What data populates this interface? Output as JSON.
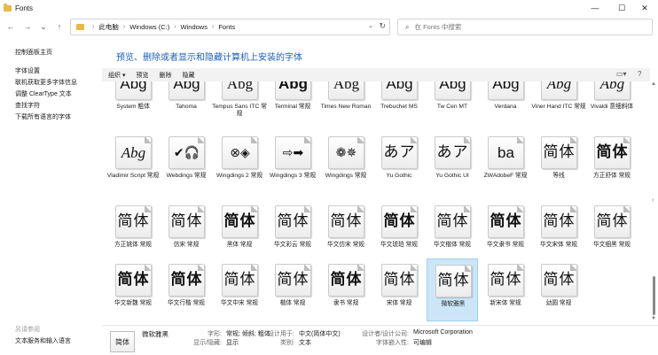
{
  "window": {
    "title": "Fonts",
    "min": "—",
    "max": "☐",
    "close": "✕"
  },
  "nav": {
    "back": "←",
    "forward": "→",
    "history": "⌄",
    "up": "↑",
    "breadcrumb": [
      "此电脑",
      "Windows (C:)",
      "Windows",
      "Fonts"
    ],
    "search_placeholder": "在 Fonts 中搜索"
  },
  "left": {
    "home": "控制面板主页",
    "links": [
      "字体设置",
      "联机获取更多字体信息",
      "调整 ClearType 文本",
      "查找字符",
      "下载所有语言的字体"
    ],
    "see_also": "另请参阅",
    "see_also_links": [
      "文本服务和输入语言"
    ]
  },
  "header": {
    "title": "预览、删除或者显示和隐藏计算机上安装的字体"
  },
  "toolbar": {
    "organize": "组织 ▾",
    "preview": "预览",
    "delete": "删除",
    "hide": "隐藏"
  },
  "fonts": [
    {
      "sample": "Abg",
      "style": "g-sans",
      "label": "System 粗体"
    },
    {
      "sample": "Abg",
      "style": "g-sans",
      "label": "Tahoma"
    },
    {
      "sample": "Abg",
      "style": "g-serif",
      "label": "Tempus Sans ITC 常规"
    },
    {
      "sample": "Abg",
      "style": "g-sans g-bold",
      "label": "Terminal 常规"
    },
    {
      "sample": "Abg",
      "style": "g-serif",
      "label": "Times New Roman"
    },
    {
      "sample": "Abg",
      "style": "g-sans",
      "label": "Trebuchet MS"
    },
    {
      "sample": "Abg",
      "style": "g-sans",
      "label": "Tw Cen MT"
    },
    {
      "sample": "Abg",
      "style": "g-sans",
      "label": "Verdana"
    },
    {
      "sample": "Abg",
      "style": "g-italic",
      "label": "Viner Hand ITC 常规"
    },
    {
      "sample": "Abg",
      "style": "g-italic",
      "label": "Vivaldi 意细斜体"
    },
    {
      "sample": "Abg",
      "style": "g-italic",
      "label": "Vladimir Script 常规"
    },
    {
      "sample": "✔🎧",
      "style": "g-sym",
      "label": "Webdings 常规"
    },
    {
      "sample": "⊗◈",
      "style": "g-sym",
      "label": "Wingdings 2 常规"
    },
    {
      "sample": "⇨➡",
      "style": "g-sym",
      "label": "Wingdings 3 常规"
    },
    {
      "sample": "❁✵",
      "style": "g-sym",
      "label": "Wingdings 常规"
    },
    {
      "sample": "あア",
      "style": "g-cjk",
      "label": "Yu Gothic"
    },
    {
      "sample": "あア",
      "style": "g-cjk",
      "label": "Yu Gothic UI"
    },
    {
      "sample": "ba",
      "style": "g-sans",
      "label": "ZWAdobeF 常规"
    },
    {
      "sample": "简体",
      "style": "g-cjk",
      "label": "等线"
    },
    {
      "sample": "简体",
      "style": "g-cjk g-bold",
      "label": "方正舒体 常规"
    },
    {
      "sample": "简体",
      "style": "g-cjk",
      "label": "方正姚体 常规"
    },
    {
      "sample": "简体",
      "style": "g-cjk",
      "label": "仿宋 常规"
    },
    {
      "sample": "简体",
      "style": "g-cjk g-bold",
      "label": "黑体 常规"
    },
    {
      "sample": "简体",
      "style": "g-cjk",
      "label": "华文彩云 常规"
    },
    {
      "sample": "简体",
      "style": "g-cjk",
      "label": "华文仿宋 常规"
    },
    {
      "sample": "简体",
      "style": "g-cjk g-bold",
      "label": "华文琥珀 常规"
    },
    {
      "sample": "简体",
      "style": "g-cjk",
      "label": "华文楷体 常规"
    },
    {
      "sample": "简体",
      "style": "g-cjk g-bold",
      "label": "华文隶书 常规"
    },
    {
      "sample": "简体",
      "style": "g-cjk",
      "label": "华文宋体 常规"
    },
    {
      "sample": "简体",
      "style": "g-cjk",
      "label": "华文细黑 常规"
    },
    {
      "sample": "简体",
      "style": "g-cjk g-bold",
      "label": "华文新魏 常规"
    },
    {
      "sample": "简体",
      "style": "g-cjk g-bold",
      "label": "华文行楷 常规"
    },
    {
      "sample": "简体",
      "style": "g-cjk",
      "label": "华文中宋 常规"
    },
    {
      "sample": "简体",
      "style": "g-cjk",
      "label": "楷体 常规"
    },
    {
      "sample": "简体",
      "style": "g-cjk g-bold",
      "label": "隶书 常规"
    },
    {
      "sample": "简体",
      "style": "g-cjk",
      "label": "宋体 常规"
    },
    {
      "sample": "简体",
      "style": "g-cjk",
      "label": "微软雅黑",
      "selected": true
    },
    {
      "sample": "简体",
      "style": "g-cjk",
      "label": "新宋体 常规"
    },
    {
      "sample": "简体",
      "style": "g-cjk",
      "label": "幼圆 常规"
    }
  ],
  "details": {
    "icon_text": "简体",
    "name": "微软雅黑",
    "style_label": "字形:",
    "style_value": "常规; 倾斜; 粗体",
    "show_label": "显示/隐藏:",
    "show_value": "显示",
    "designed_label": "设计用于:",
    "designed_value": "中文(简体中文)",
    "category_label": "类别:",
    "category_value": "文本",
    "designer_label": "设计者/设计公司:",
    "designer_value": "Microsoft Corporation",
    "embed_label": "字体嵌入性:",
    "embed_value": "可编辑"
  }
}
